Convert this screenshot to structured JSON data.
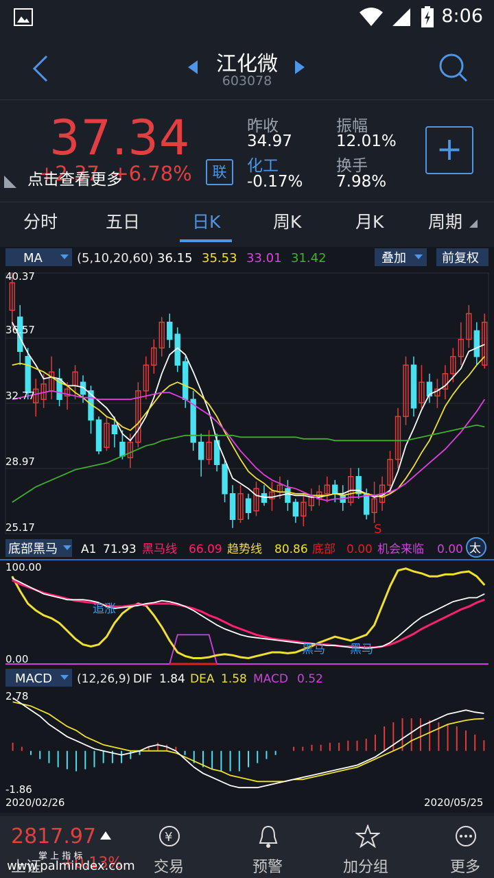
{
  "status": {
    "time": "8:06"
  },
  "header": {
    "title": "江化微",
    "code": "603078"
  },
  "quote": {
    "price": "37.34",
    "change": "+2.37",
    "change_pct": "+6.78%",
    "hint": "点击查看更多",
    "lian": "联",
    "prev_close_label": "昨收",
    "prev_close": "34.97",
    "sector": "化工",
    "sector_change": "-0.17%",
    "amplitude_label": "振幅",
    "amplitude": "12.01%",
    "turnover_label": "换手",
    "turnover": "7.98%",
    "add_label": "+"
  },
  "tabs": [
    "分时",
    "五日",
    "日K",
    "周K",
    "月K",
    "周期"
  ],
  "active_tab": 2,
  "ma_bar": {
    "selector": "MA",
    "params": "(5,10,20,60)",
    "v1": "36.15",
    "v2": "35.53",
    "v3": "33.01",
    "v4": "31.42",
    "overlay": "叠加",
    "adjust": "前复权",
    "colors": [
      "#ffffff",
      "#f0e030",
      "#e040e0",
      "#40b030"
    ]
  },
  "main_axis": {
    "labels": [
      "40.37",
      "36.57",
      "32.77",
      "28.97",
      "25.17"
    ],
    "signal": "S"
  },
  "ind1_bar": {
    "selector": "底部黑马",
    "a1_label": "A1",
    "a1": "71.93",
    "hm_label": "黑马线",
    "hm": "66.09",
    "trend_label": "趋势线",
    "trend": "80.86",
    "bottom_label": "底部",
    "bottom": "0.00",
    "chance_label": "机会来临",
    "chance": "0.00",
    "icon_label": "太"
  },
  "ind1_axis": {
    "top": "100.00",
    "bottom": "0.00"
  },
  "ind1_marks": {
    "chase": "追涨",
    "hm1": "黑马",
    "hm2": "黑马"
  },
  "macd_bar": {
    "selector": "MACD",
    "params": "(12,26,9)",
    "dif_label": "DIF",
    "dif": "1.84",
    "dea_label": "DEA",
    "dea": "1.58",
    "macd_label": "MACD",
    "macd": "0.52"
  },
  "macd_axis": {
    "top": "2.78",
    "bottom": "-1.86"
  },
  "dates": {
    "start": "2020/02/26",
    "end": "2020/05/25"
  },
  "bottom_nav": {
    "index_value": "2817.97",
    "index_name": "上证",
    "index_change": "+0.13%",
    "items": [
      "交易",
      "预警",
      "加分组",
      "更多"
    ]
  },
  "watermark": {
    "site": "www.palmindex.com",
    "cn": "掌 上 指 标"
  },
  "chart_data": {
    "type": "candlestick",
    "series_names": [
      "MA5",
      "MA10",
      "MA20",
      "MA60"
    ],
    "ylim": [
      25.17,
      40.37
    ],
    "candles": [
      [
        38.2,
        39.8,
        40.4,
        37.2
      ],
      [
        37.8,
        35.8,
        38.5,
        35.0
      ],
      [
        35.5,
        33.4,
        36.0,
        33.0
      ],
      [
        32.8,
        33.6,
        34.2,
        32.0
      ],
      [
        33.0,
        33.9,
        34.5,
        32.5
      ],
      [
        33.5,
        34.6,
        35.5,
        33.0
      ],
      [
        34.2,
        33.0,
        34.8,
        32.6
      ],
      [
        33.2,
        33.6,
        34.0,
        32.4
      ],
      [
        33.8,
        34.6,
        35.0,
        33.0
      ],
      [
        34.0,
        33.3,
        34.4,
        32.8
      ],
      [
        33.5,
        31.8,
        33.8,
        31.0
      ],
      [
        31.8,
        30.0,
        32.0,
        29.8
      ],
      [
        30.2,
        31.6,
        32.0,
        30.0
      ],
      [
        31.5,
        31.0,
        32.0,
        30.2
      ],
      [
        30.5,
        29.7,
        31.2,
        29.5
      ],
      [
        29.6,
        30.5,
        31.0,
        29.0
      ],
      [
        30.5,
        33.5,
        34.0,
        30.2
      ],
      [
        33.5,
        35.0,
        35.5,
        33.0
      ],
      [
        35.0,
        36.0,
        36.5,
        34.5
      ],
      [
        36.0,
        37.5,
        37.8,
        35.5
      ],
      [
        37.5,
        36.5,
        38.0,
        36.0
      ],
      [
        36.8,
        35.0,
        37.2,
        34.6
      ],
      [
        35.2,
        33.0,
        35.5,
        32.5
      ],
      [
        33.0,
        30.5,
        33.5,
        30.0
      ],
      [
        30.5,
        29.5,
        31.0,
        28.5
      ],
      [
        29.5,
        30.5,
        31.2,
        29.2
      ],
      [
        30.6,
        29.2,
        31.0,
        28.8
      ],
      [
        29.2,
        27.5,
        29.5,
        27.0
      ],
      [
        27.5,
        26.0,
        28.0,
        25.5
      ],
      [
        26.0,
        27.5,
        28.0,
        25.8
      ],
      [
        27.2,
        26.4,
        27.5,
        26.0
      ],
      [
        26.5,
        27.8,
        28.2,
        26.2
      ],
      [
        27.5,
        27.0,
        28.0,
        26.8
      ],
      [
        27.2,
        27.6,
        28.2,
        26.5
      ],
      [
        27.6,
        28.0,
        28.5,
        27.2
      ],
      [
        27.8,
        27.0,
        28.3,
        26.5
      ],
      [
        27.0,
        26.2,
        27.2,
        25.8
      ],
      [
        26.2,
        27.0,
        27.5,
        25.6
      ],
      [
        26.8,
        27.3,
        27.8,
        26.5
      ],
      [
        27.2,
        27.6,
        28.0,
        26.8
      ],
      [
        27.5,
        28.0,
        28.5,
        27.0
      ],
      [
        28.0,
        27.5,
        28.3,
        27.0
      ],
      [
        27.4,
        27.0,
        28.0,
        26.5
      ],
      [
        27.0,
        28.5,
        29.0,
        26.8
      ],
      [
        28.5,
        27.5,
        29.0,
        27.2
      ],
      [
        27.5,
        26.3,
        27.8,
        26.0
      ],
      [
        26.4,
        27.2,
        28.2,
        25.8
      ],
      [
        27.0,
        28.0,
        28.5,
        26.5
      ],
      [
        28.0,
        29.5,
        30.0,
        27.5
      ],
      [
        29.5,
        32.0,
        32.5,
        29.0
      ],
      [
        32.0,
        35.0,
        35.5,
        31.5
      ],
      [
        35.0,
        32.5,
        35.5,
        32.0
      ],
      [
        32.8,
        34.0,
        35.0,
        32.5
      ],
      [
        34.0,
        33.2,
        34.5,
        32.8
      ],
      [
        33.2,
        33.6,
        34.2,
        32.5
      ],
      [
        33.6,
        34.5,
        35.0,
        33.0
      ],
      [
        34.5,
        35.5,
        36.0,
        34.0
      ],
      [
        35.5,
        36.5,
        37.5,
        35.0
      ],
      [
        36.5,
        38.0,
        38.5,
        36.0
      ],
      [
        37.0,
        35.5,
        37.5,
        35.0
      ],
      [
        35.0,
        37.5,
        38.0,
        34.8
      ]
    ],
    "ma": {
      "MA5": [
        37.5,
        36.6,
        35.7,
        35.0,
        34.2,
        34.3,
        34.2,
        33.8,
        33.8,
        33.7,
        33.3,
        32.9,
        32.5,
        31.9,
        31.0,
        30.6,
        31.2,
        32.0,
        33.1,
        34.5,
        35.6,
        36.0,
        35.6,
        34.6,
        33.5,
        32.3,
        30.6,
        29.5,
        28.4,
        28.1,
        27.8,
        27.4,
        27.3,
        27.3,
        27.4,
        27.5,
        27.4,
        27.4,
        27.3,
        27.3,
        27.4,
        27.5,
        27.5,
        27.7,
        27.7,
        27.5,
        27.3,
        27.4,
        27.7,
        28.8,
        30.3,
        31.3,
        32.4,
        33.3,
        33.5,
        33.8,
        34.3,
        34.8,
        35.8,
        36.0,
        36.2
      ],
      "MA10": [
        35.0,
        35.1,
        35.0,
        34.8,
        34.6,
        34.3,
        34.0,
        33.8,
        33.4,
        33.1,
        32.7,
        32.4,
        32.0,
        31.8,
        31.4,
        31.2,
        31.6,
        32.2,
        32.8,
        33.4,
        33.8,
        34.0,
        33.8,
        33.6,
        33.2,
        32.7,
        32.0,
        31.1,
        30.3,
        29.5,
        28.8,
        28.4,
        28.1,
        27.7,
        27.6,
        27.6,
        27.5,
        27.5,
        27.4,
        27.4,
        27.4,
        27.5,
        27.4,
        27.5,
        27.6,
        27.5,
        27.4,
        27.3,
        27.5,
        27.8,
        28.4,
        29.1,
        29.9,
        30.6,
        31.6,
        32.6,
        33.3,
        33.9,
        34.4,
        35.0,
        35.5
      ],
      "MA20": [
        33.0,
        33.1,
        33.2,
        33.3,
        33.4,
        33.5,
        33.4,
        33.3,
        33.2,
        33.1,
        33.1,
        33.0,
        33.0,
        33.0,
        33.0,
        33.0,
        33.1,
        33.2,
        33.3,
        33.4,
        33.4,
        33.2,
        33.0,
        32.7,
        32.4,
        32.1,
        31.7,
        31.2,
        30.6,
        30.0,
        29.5,
        29.0,
        28.6,
        28.3,
        28.1,
        27.9,
        27.8,
        27.6,
        27.4,
        27.2,
        27.1,
        27.2,
        27.2,
        27.3,
        27.3,
        27.4,
        27.4,
        27.5,
        27.6,
        27.8,
        28.1,
        28.5,
        28.9,
        29.3,
        29.7,
        30.1,
        30.6,
        31.1,
        31.7,
        32.3,
        33.0
      ],
      "MA60": [
        27.0,
        27.3,
        27.6,
        27.9,
        28.1,
        28.3,
        28.5,
        28.7,
        28.9,
        29.0,
        29.1,
        29.2,
        29.3,
        29.5,
        29.7,
        29.9,
        30.1,
        30.3,
        30.4,
        30.6,
        30.7,
        30.8,
        30.9,
        30.9,
        30.9,
        30.9,
        30.9,
        30.9,
        30.9,
        30.8,
        30.8,
        30.8,
        30.8,
        30.8,
        30.8,
        30.8,
        30.8,
        30.7,
        30.7,
        30.7,
        30.7,
        30.6,
        30.6,
        30.6,
        30.6,
        30.6,
        30.6,
        30.6,
        30.6,
        30.6,
        30.6,
        30.7,
        30.8,
        30.9,
        31.0,
        31.1,
        31.2,
        31.3,
        31.4,
        31.5,
        31.4
      ]
    },
    "indicator1": {
      "ylim": [
        0,
        100
      ],
      "A1": [
        88,
        84,
        80,
        76,
        72,
        70,
        68,
        66,
        66,
        66,
        65,
        63,
        59,
        57,
        58,
        59,
        60,
        62,
        63,
        65,
        64,
        62,
        59,
        55,
        50,
        45,
        40,
        36,
        33,
        30,
        28,
        27,
        26,
        25,
        24,
        23,
        22,
        21,
        21,
        20,
        19,
        19,
        18,
        17,
        17,
        16,
        17,
        18,
        22,
        28,
        35,
        42,
        48,
        52,
        56,
        60,
        64,
        66,
        68,
        68,
        72
      ],
      "hm": [
        86,
        82,
        79,
        76,
        73,
        71,
        69,
        67,
        65,
        64,
        63,
        62,
        60,
        59,
        59,
        60,
        61,
        61,
        62,
        62,
        62,
        61,
        59,
        57,
        54,
        50,
        47,
        43,
        39,
        36,
        33,
        30,
        28,
        26,
        25,
        24,
        23,
        22,
        21,
        20,
        20,
        19,
        18,
        18,
        17,
        17,
        17,
        18,
        20,
        23,
        27,
        31,
        36,
        40,
        44,
        48,
        52,
        56,
        59,
        63,
        66
      ],
      "trend": [
        90,
        75,
        62,
        55,
        50,
        47,
        42,
        34,
        26,
        20,
        18,
        20,
        28,
        42,
        52,
        58,
        62,
        60,
        50,
        38,
        24,
        12,
        8,
        6,
        6,
        7,
        9,
        10,
        9,
        7,
        6,
        8,
        10,
        12,
        12,
        11,
        12,
        15,
        18,
        22,
        25,
        28,
        26,
        24,
        27,
        30,
        40,
        60,
        80,
        96,
        98,
        95,
        93,
        90,
        90,
        92,
        92,
        94,
        95,
        90,
        81
      ],
      "bottom_window": [
        21,
        25
      ]
    },
    "macd": {
      "ylim": [
        -1.86,
        2.78
      ],
      "dif": [
        2.6,
        2.3,
        2.0,
        1.7,
        1.3,
        1.0,
        0.7,
        0.5,
        0.3,
        0.1,
        0.0,
        -0.1,
        -0.2,
        -0.1,
        0.0,
        0.2,
        0.3,
        0.2,
        0.0,
        -0.4,
        -0.8,
        -1.1,
        -1.3,
        -1.5,
        -1.7,
        -1.8,
        -1.8,
        -1.8,
        -1.7,
        -1.6,
        -1.5,
        -1.4,
        -1.3,
        -1.2,
        -1.1,
        -1.0,
        -0.9,
        -0.8,
        -0.7,
        -0.5,
        -0.3,
        0.0,
        0.3,
        0.6,
        0.9,
        1.2,
        1.4,
        1.6,
        1.8,
        1.9,
        2.0,
        1.9,
        1.84
      ],
      "dea": [
        2.4,
        2.3,
        2.2,
        2.0,
        1.8,
        1.5,
        1.2,
        1.0,
        0.7,
        0.5,
        0.3,
        0.2,
        0.1,
        0.0,
        0.0,
        0.0,
        0.0,
        0.0,
        -0.1,
        -0.3,
        -0.5,
        -0.7,
        -0.9,
        -1.0,
        -1.2,
        -1.3,
        -1.4,
        -1.5,
        -1.5,
        -1.5,
        -1.5,
        -1.4,
        -1.4,
        -1.3,
        -1.2,
        -1.1,
        -1.0,
        -0.9,
        -0.8,
        -0.6,
        -0.4,
        -0.2,
        0.0,
        0.2,
        0.5,
        0.7,
        0.9,
        1.1,
        1.3,
        1.4,
        1.5,
        1.56,
        1.58
      ],
      "hist": [
        0.4,
        0.2,
        -0.2,
        -0.4,
        -0.6,
        -0.8,
        -0.9,
        -1.0,
        -0.9,
        -0.8,
        -0.6,
        -0.6,
        -0.6,
        -0.4,
        -0.2,
        0.2,
        0.4,
        0.3,
        0.2,
        -0.2,
        -0.6,
        -0.8,
        -0.9,
        -1.0,
        -1.0,
        -1.0,
        -0.8,
        -0.6,
        -0.4,
        -0.2,
        0.0,
        0.2,
        0.2,
        0.3,
        0.3,
        0.4,
        0.4,
        0.5,
        0.5,
        0.6,
        0.8,
        1.2,
        1.4,
        1.6,
        1.6,
        1.6,
        1.5,
        1.4,
        1.3,
        1.2,
        1.0,
        0.8,
        0.52
      ]
    }
  }
}
